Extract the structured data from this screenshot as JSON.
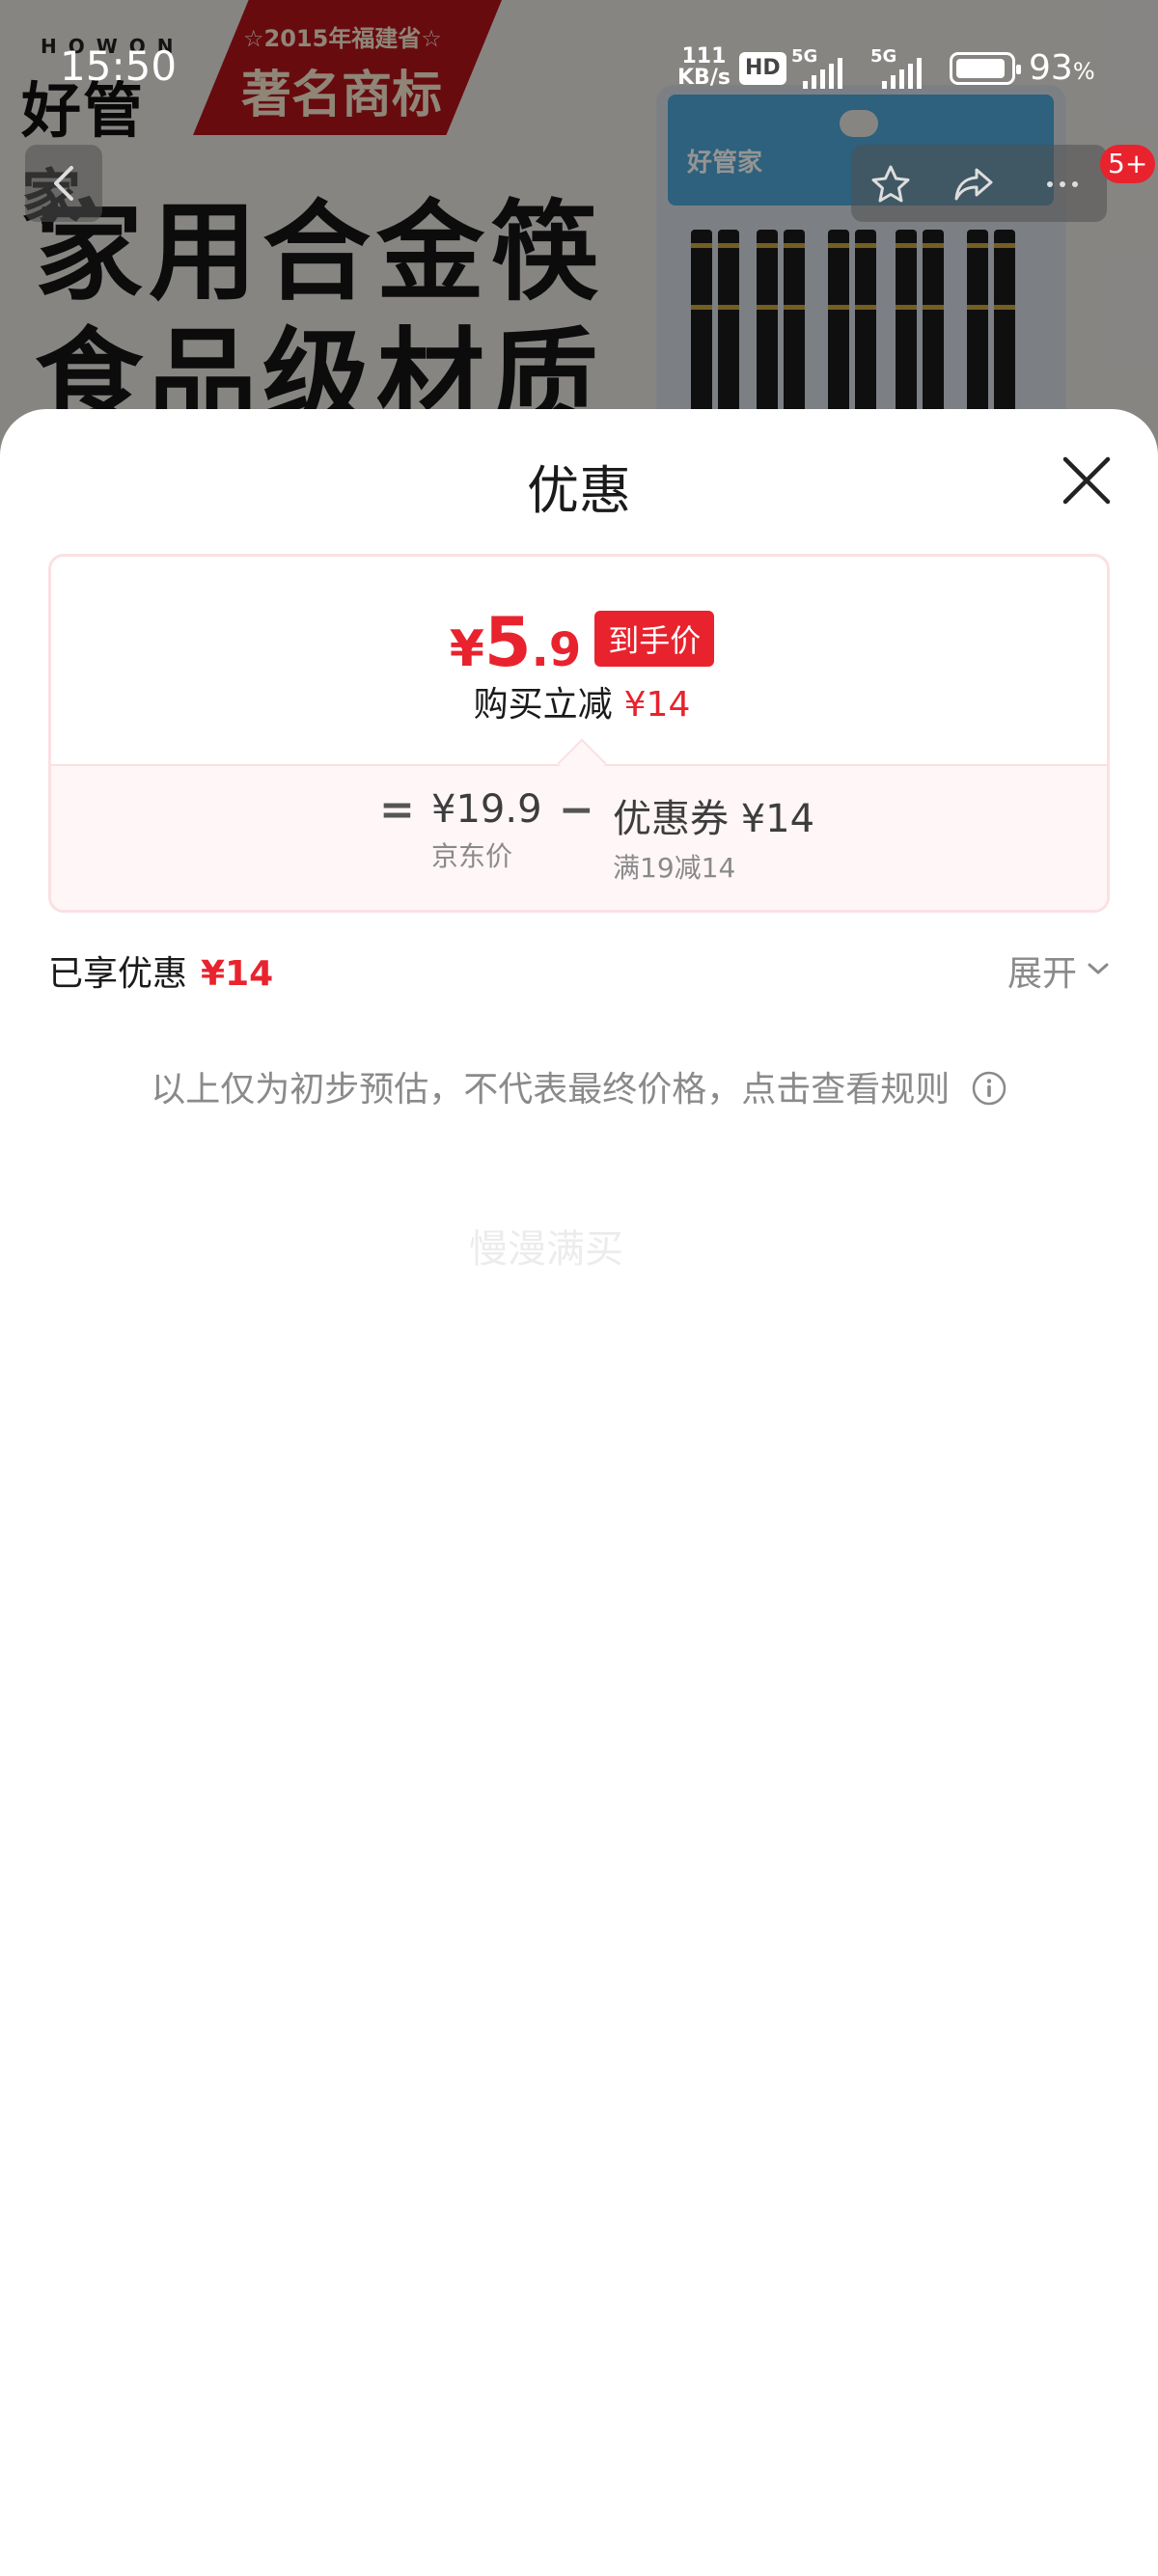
{
  "status_bar": {
    "time": "15:50",
    "net_speed_value": "111",
    "net_speed_unit": "KB/s",
    "hd_label": "HD",
    "signal1_label": "5G",
    "signal2_label": "5G",
    "battery_pct": "93",
    "battery_unit": "%"
  },
  "hero": {
    "brand_letters": "HOWON",
    "brand_name": "好管家",
    "trademark_sub": "☆2015年福建省☆",
    "trademark_main": "著名商标",
    "headline_line1": "家用合金筷",
    "headline_line2": "食品级材质",
    "package_label": "好管家",
    "cart_badge": "5+"
  },
  "sheet": {
    "title": "优惠",
    "final_price": {
      "currency": "¥",
      "integer": "5",
      "decimal": ".9",
      "tag": "到手价"
    },
    "saving_label": "购买立减",
    "saving_amount": "¥14",
    "calc": {
      "equals": "=",
      "minus": "−",
      "base_price": "¥19.9",
      "base_label": "京东价",
      "coupon_value": "优惠券 ¥14",
      "coupon_label": "满19减14"
    },
    "enjoyed_label": "已享优惠",
    "enjoyed_amount": "¥14",
    "expand_label": "展开",
    "disclaimer": "以上仅为初步预估，不代表最终价格，点击查看规则",
    "toast": "慢漫满买"
  },
  "colors": {
    "accent": "#e8232e",
    "card_border": "#fbe0e3",
    "muted": "#8a8a8a"
  }
}
